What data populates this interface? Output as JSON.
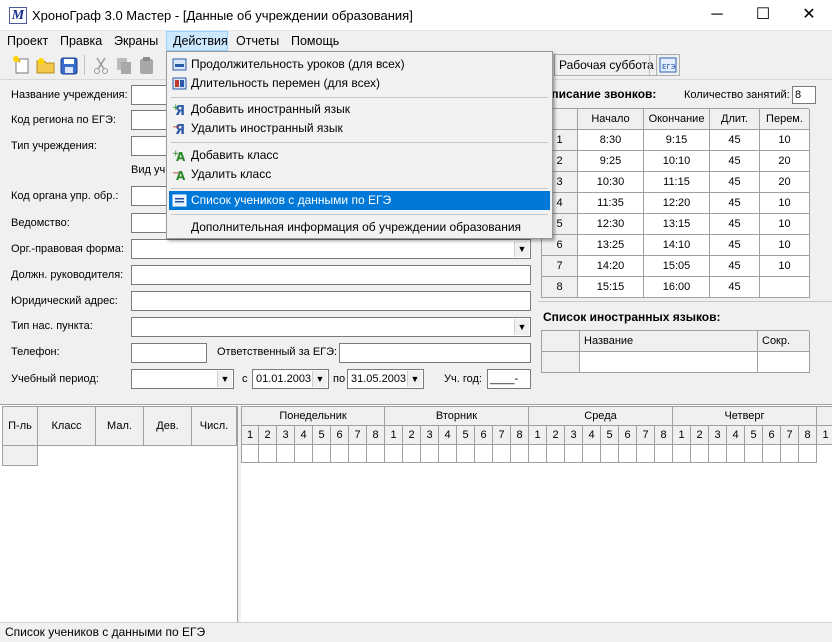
{
  "window": {
    "title": "ХроноГраф 3.0 Мастер - [Данные об учреждении образования]",
    "icon_letter": "M",
    "controls": {
      "minimize": "─",
      "maximize": "☐",
      "close": "✕"
    }
  },
  "menubar": [
    "Проект",
    "Правка",
    "Экраны",
    "Действия",
    "Отчеты",
    "Помощь"
  ],
  "toolbar": {
    "saturday_label": "Рабочая суббота",
    "ege_label": "ЕГЭ"
  },
  "actions_menu": {
    "items": [
      {
        "label": "Продолжительность уроков (для всех)",
        "icon": "lesson-duration-icon"
      },
      {
        "label": "Длительность перемен (для всех)",
        "icon": "break-duration-icon"
      },
      {
        "label": "Добавить иностранный язык",
        "icon": "add-language-icon"
      },
      {
        "label": "Удалить иностранный язык",
        "icon": "delete-language-icon"
      },
      {
        "label": "Добавить класс",
        "icon": "add-class-icon"
      },
      {
        "label": "Удалить класс",
        "icon": "delete-class-icon"
      },
      {
        "label": "Список учеников с данными по ЕГЭ",
        "icon": "ege-list-icon"
      },
      {
        "label": "Дополнительная информация об учреждении образования",
        "icon": ""
      }
    ]
  },
  "form": {
    "name_label": "Название учреждения:",
    "region_label": "Код региона по ЕГЭ:",
    "type_label": "Тип учреждения:",
    "kind_label": "Вид уч",
    "authority_label": "Код органа упр. обр.:",
    "department_label": "Ведомство:",
    "legal_form_label": "Орг.-правовая форма:",
    "head_label": "Должн. руководителя:",
    "address_label": "Юридический адрес:",
    "settlement_label": "Тип нас. пункта:",
    "phone_label": "Телефон:",
    "ege_resp_label": "Ответственный за ЕГЭ:",
    "period_label": "Учебный период:",
    "from_label": "с",
    "from_date": "01.01.2003",
    "to_label": "по",
    "to_date": "31.05.2003",
    "year_label": "Уч. год:",
    "year_value": "____-__"
  },
  "bells": {
    "title": "асписание звонков:",
    "count_label": "Количество занятий:",
    "count_value": "8",
    "headers": [
      "",
      "Начало",
      "Окончание",
      "Длит.",
      "Перем."
    ],
    "rows": [
      [
        "1",
        "8:30",
        "9:15",
        "45",
        "10"
      ],
      [
        "2",
        "9:25",
        "10:10",
        "45",
        "20"
      ],
      [
        "3",
        "10:30",
        "11:15",
        "45",
        "20"
      ],
      [
        "4",
        "11:35",
        "12:20",
        "45",
        "10"
      ],
      [
        "5",
        "12:30",
        "13:15",
        "45",
        "10"
      ],
      [
        "6",
        "13:25",
        "14:10",
        "45",
        "10"
      ],
      [
        "7",
        "14:20",
        "15:05",
        "45",
        "10"
      ],
      [
        "8",
        "15:15",
        "16:00",
        "45",
        ""
      ]
    ]
  },
  "languages": {
    "title": "Список иностранных языков:",
    "headers": [
      "Название",
      "Сокр."
    ]
  },
  "classes": {
    "headers": [
      "П-ль",
      "Класс",
      "Мал.",
      "Дев.",
      "Числ."
    ]
  },
  "schedule": {
    "days": [
      "Понедельник",
      "Вторник",
      "Среда",
      "Четверг"
    ],
    "periods": [
      "1",
      "2",
      "3",
      "4",
      "5",
      "6",
      "7",
      "8"
    ]
  },
  "statusbar": {
    "text": "Список учеников с данными по ЕГЭ"
  }
}
